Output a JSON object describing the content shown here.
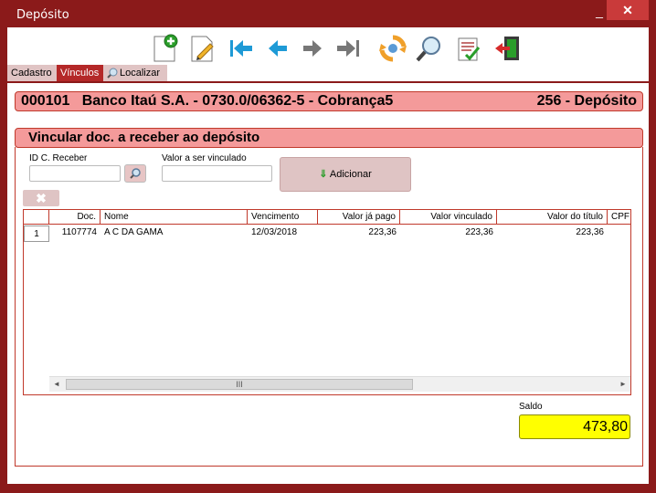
{
  "window": {
    "title": "Depósito",
    "minimize_label": "_",
    "close_label": "✕"
  },
  "toolbar": {
    "buttons": [
      {
        "icon": "new-document-icon"
      },
      {
        "icon": "edit-document-icon"
      },
      {
        "icon": "first-record-icon"
      },
      {
        "icon": "previous-record-icon"
      },
      {
        "icon": "next-record-icon"
      },
      {
        "icon": "last-record-icon"
      },
      {
        "icon": "refresh-icon"
      },
      {
        "icon": "search-icon"
      },
      {
        "icon": "checklist-icon"
      },
      {
        "icon": "exit-icon"
      }
    ]
  },
  "tabs": [
    {
      "label": "Cadastro",
      "active": false
    },
    {
      "label": "Vínculos",
      "active": true
    },
    {
      "label": "Localizar",
      "active": false,
      "icon": "magnifier-icon"
    }
  ],
  "header": {
    "account": "000101   Banco Itaú S.A. - 0730.0/06362-5 - Cobrança5",
    "deposit": "256 - Depósito"
  },
  "section": {
    "title": "Vincular doc. a receber ao depósito",
    "id_label": "ID C. Receber",
    "id_value": "",
    "valor_label": "Valor a ser vinculado",
    "valor_value": "",
    "add_label": "Adicionar",
    "delete_label": "✖"
  },
  "grid": {
    "columns": [
      "Doc.",
      "Nome",
      "Vencimento",
      "Valor já pago",
      "Valor vinculado",
      "Valor do título",
      "CPF"
    ],
    "rows": [
      {
        "num": "1",
        "doc": "1107774",
        "nome": "A C DA GAMA",
        "vencimento": "12/03/2018",
        "valor_pago": "223,36",
        "valor_vinculado": "223,36",
        "valor_titulo": "223,36",
        "cpf": ""
      }
    ],
    "scroll_thumb_label": "III"
  },
  "saldo": {
    "label": "Saldo",
    "value": "473,80"
  },
  "colors": {
    "frame": "#8b1a1a",
    "banner": "#f49a9a",
    "saldo_bg": "#ffff00",
    "active_tab": "#b42828"
  }
}
